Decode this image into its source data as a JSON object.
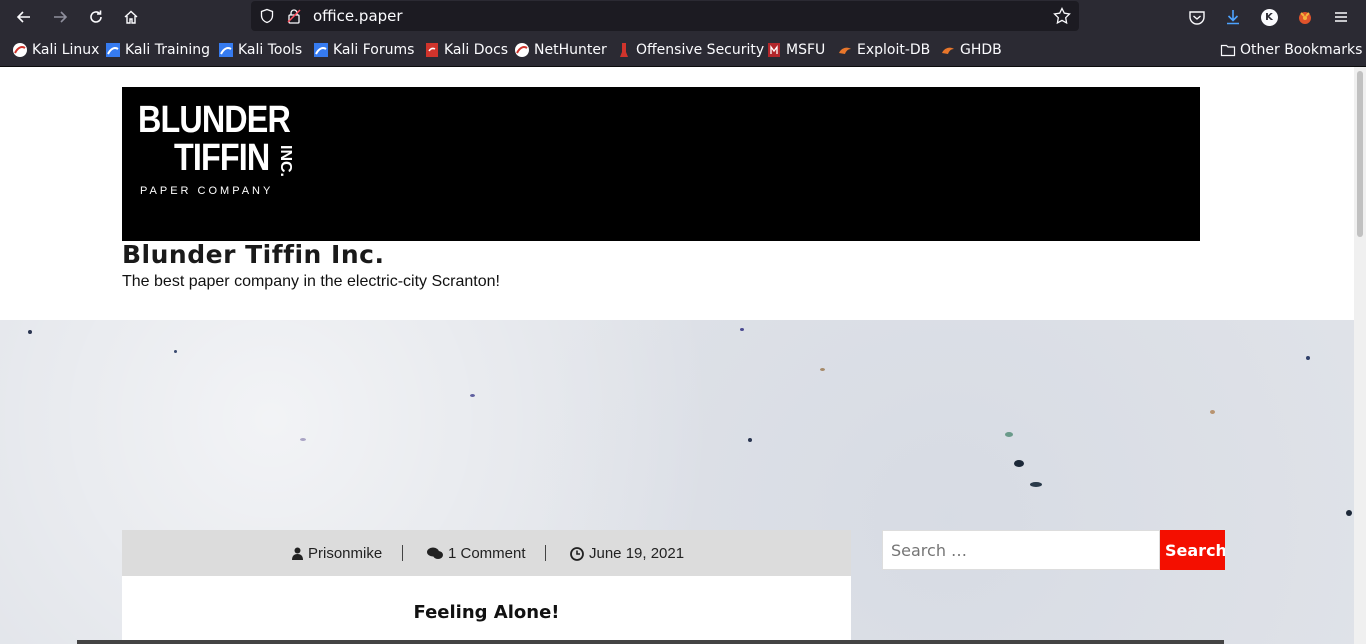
{
  "browser": {
    "url": "office.paper",
    "bookmarks": [
      {
        "label": "Kali Linux",
        "icon": "kali-icon"
      },
      {
        "label": "Kali Training",
        "icon": "kali-training-icon"
      },
      {
        "label": "Kali Tools",
        "icon": "kali-tools-icon"
      },
      {
        "label": "Kali Forums",
        "icon": "kali-forums-icon"
      },
      {
        "label": "Kali Docs",
        "icon": "kali-docs-icon"
      },
      {
        "label": "NetHunter",
        "icon": "nethunter-icon"
      },
      {
        "label": "Offensive Security",
        "icon": "offsec-icon"
      },
      {
        "label": "MSFU",
        "icon": "msfu-icon"
      },
      {
        "label": "Exploit-DB",
        "icon": "exploitdb-icon"
      },
      {
        "label": "GHDB",
        "icon": "ghdb-icon"
      }
    ],
    "other_bookmarks": "Other Bookmarks",
    "account_initial": "K"
  },
  "site": {
    "logo": {
      "line1": "BLUNDER",
      "line2": "TIFFIN",
      "inc": "INC.",
      "sub": "PAPER COMPANY"
    },
    "title": "Blunder Tiffin Inc.",
    "description": "The best paper company in the electric-city Scranton!"
  },
  "post": {
    "author": "Prisonmike",
    "comments": "1 Comment",
    "date": "June 19, 2021",
    "title": "Feeling Alone!"
  },
  "search": {
    "placeholder": "Search …",
    "button_label": "Search"
  },
  "colors": {
    "chrome_bg": "#2b2a33",
    "accent_red": "#f40f00"
  }
}
